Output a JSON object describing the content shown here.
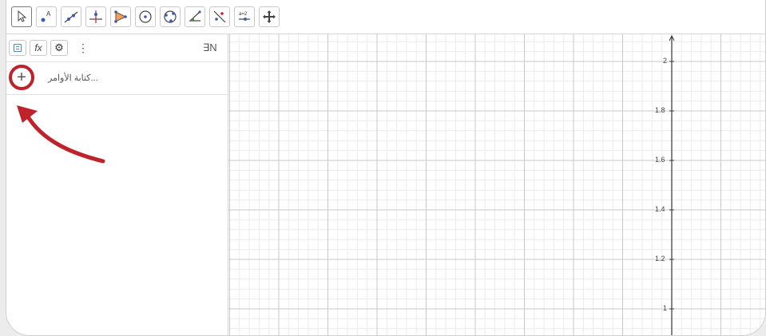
{
  "toolbar": {
    "tools": [
      {
        "name": "move-tool-icon"
      },
      {
        "name": "point-tool-icon"
      },
      {
        "name": "line-tool-icon"
      },
      {
        "name": "perpendicular-line-tool-icon"
      },
      {
        "name": "polygon-tool-icon"
      },
      {
        "name": "circle-center-point-tool-icon"
      },
      {
        "name": "circle-three-points-tool-icon"
      },
      {
        "name": "angle-tool-icon"
      },
      {
        "name": "reflect-tool-icon"
      },
      {
        "name": "slider-tool-icon",
        "label": "a=2"
      },
      {
        "name": "move-graphics-view-tool-icon"
      }
    ]
  },
  "algebra": {
    "fx_label": "fx",
    "menu_dots": "⋮",
    "sort_icon_label": "∃N",
    "input_placeholder": "...كتابة الأوامر",
    "plus_label": "+"
  },
  "graph": {
    "y_ticks": [
      "2",
      "1.8",
      "1.6",
      "1.4",
      "1.2",
      "1"
    ]
  },
  "colors": {
    "annotation": "#c0222c",
    "grid_major": "#c9c9c9",
    "grid_minor": "#ececec"
  }
}
